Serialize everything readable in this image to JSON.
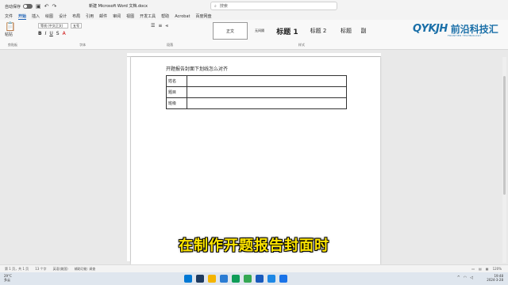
{
  "titlebar": {
    "autosave_label": "自动保存",
    "document_title": "新建 Microsoft Word 文档.docx",
    "search_placeholder": "搜索"
  },
  "menu": {
    "tabs": [
      "文件",
      "开始",
      "插入",
      "绘图",
      "设计",
      "布局",
      "引用",
      "邮件",
      "审阅",
      "视图",
      "开发工具",
      "帮助",
      "Acrobat",
      "百度网盘"
    ]
  },
  "ribbon": {
    "paste_label": "粘贴",
    "font_name": "等线 (中文正文)",
    "font_size": "五号",
    "clipboard_label": "剪贴板",
    "font_label": "字体",
    "paragraph_label": "段落",
    "styles_label": "样式",
    "styles": [
      {
        "label": "正文"
      },
      {
        "label": "无间隔"
      },
      {
        "label": "标题 1"
      },
      {
        "label": "标题 2"
      },
      {
        "label": "标题"
      },
      {
        "label": "副"
      }
    ]
  },
  "logo": {
    "mark": "QYKJH",
    "name": "前沿科技汇",
    "tagline": "FRONTIER TECHNOLOGY"
  },
  "document": {
    "heading": "开题报告封面下划线怎么对齐",
    "rows": [
      {
        "label": "姓名",
        "value": ""
      },
      {
        "label": "题目",
        "value": ""
      },
      {
        "label": "班级",
        "value": ""
      }
    ]
  },
  "subtitle": "在制作开题报告封面时",
  "statusbar": {
    "page": "第 1 页，共 1 页",
    "words": "13 个字",
    "language": "英语(美国)",
    "mode": "辅助功能: 调查",
    "zoom": "120%"
  },
  "taskbar": {
    "weather_temp": "29°C",
    "weather_desc": "多云",
    "time": "19:48",
    "date": "2024-3-28",
    "icon_colors": [
      "#0078d4",
      "#1e3a5f",
      "#f4b400",
      "#2b7cd3",
      "#0f9d58",
      "#34a853",
      "#185abd",
      "#1e88e5",
      "#1a73e8"
    ]
  }
}
